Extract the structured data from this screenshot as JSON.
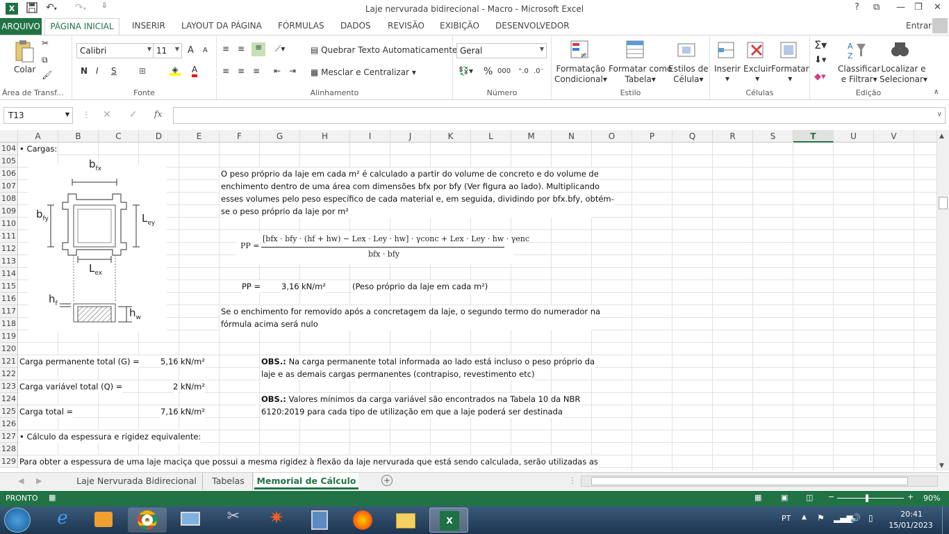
{
  "window": {
    "title": "Laje nervurada bidirecional - Macro - Microsoft Excel",
    "help": "?",
    "signin": "Entrar"
  },
  "tabs": [
    "ARQUIVO",
    "PÁGINA INICIAL",
    "INSERIR",
    "LAYOUT DA PÁGINA",
    "FÓRMULAS",
    "DADOS",
    "REVISÃO",
    "EXIBIÇÃO",
    "DESENVOLVEDOR"
  ],
  "ribbon": {
    "clipboard": {
      "paste": "Colar",
      "label": "Área de Transf..."
    },
    "font": {
      "name": "Calibri",
      "size": "11",
      "bold": "N",
      "italic": "I",
      "underline": "S",
      "label": "Fonte",
      "grow": "A",
      "shrink": "A",
      "color": "A"
    },
    "alignment": {
      "wrap": "Quebrar Texto Automaticamente",
      "merge": "Mesclar e Centralizar",
      "label": "Alinhamento"
    },
    "number": {
      "format": "Geral",
      "percent": "%",
      "thousands": "000",
      "label": "Número"
    },
    "styles": {
      "cond1": "Formatação",
      "cond2": "Condicional",
      "table1": "Formatar como",
      "table2": "Tabela",
      "cell1": "Estilos de",
      "cell2": "Célula",
      "label": "Estilo"
    },
    "cells": {
      "insert": "Inserir",
      "delete": "Excluir",
      "format": "Formatar",
      "label": "Células"
    },
    "editing": {
      "sort1": "Classificar",
      "sort2": "e Filtrar",
      "find1": "Localizar e",
      "find2": "Selecionar",
      "label": "Edição"
    }
  },
  "formula": {
    "namebox": "T13",
    "fx": "fx",
    "cancel": "✕",
    "enter": "✓"
  },
  "columns": [
    "A",
    "B",
    "C",
    "D",
    "E",
    "F",
    "G",
    "H",
    "I",
    "J",
    "K",
    "L",
    "M",
    "N",
    "O",
    "P",
    "Q",
    "R",
    "S",
    "T",
    "U",
    "V"
  ],
  "rows": [
    "104",
    "105",
    "106",
    "107",
    "108",
    "109",
    "110",
    "111",
    "112",
    "113",
    "114",
    "115",
    "116",
    "117",
    "118",
    "119",
    "120",
    "121",
    "122",
    "123",
    "124",
    "125",
    "126",
    "127",
    "128",
    "129"
  ],
  "cells": {
    "r104": "• Cargas:",
    "r106": "O peso próprio da laje em cada m² é calculado a partir do volume de concreto e do volume de",
    "r107": "enchimento dentro de uma área com dimensões bfx por bfy (Ver figura ao lado). Multiplicando",
    "r108": "esses volumes pelo peso específico de cada material e, em seguida, dividindo por bfx.bfy, obtém-",
    "r109": "se o peso próprio da laje por m²",
    "pp_label": "PP =",
    "pp_value": "3,16",
    "pp_unit": "kN/m²",
    "pp_note": "(Peso próprio da laje em cada m²)",
    "r117": "Se o enchimento for removido após a concretagem da laje, o segundo termo do numerador na",
    "r118": "fórmula acima será nulo",
    "g_label": "Carga permanente total (G) =",
    "g_value": "5,16",
    "g_unit": "kN/m²",
    "obs1_bold": "OBS.:",
    "obs1": " Na carga permanente total informada ao lado está incluso o peso próprio da",
    "obs1b": "laje e as demais cargas permanentes (contrapiso, revestimento etc)",
    "q_label": "Carga variável total (Q) =",
    "q_value": "2",
    "q_unit": "kN/m²",
    "obs2_bold": "OBS.:",
    "obs2": " Valores mínimos da carga variável são encontrados na Tabela 10 da NBR",
    "obs2b": "6120:2019 para cada tipo de utilização em que a laje poderá ser destinada",
    "t_label": "Carga total =",
    "t_value": "7,16",
    "t_unit": "kN/m²",
    "r127": "• Cálculo da espessura e rigidez equivalente:",
    "r129": "Para obter a espessura de uma laje maciça que possui a mesma rigidez à flexão da laje nervurada que está sendo calculada, serão utilizadas as"
  },
  "figure": {
    "bfx": "b",
    "bfx_sub": "fx",
    "bfy": "b",
    "bfy_sub": "fy",
    "ley": "L",
    "ley_sub": "ey",
    "lex": "L",
    "lex_sub": "ex",
    "hf": "h",
    "hf_sub": "f",
    "hw": "h",
    "hw_sub": "w"
  },
  "formula_eq": {
    "lhs": "PP =",
    "num": "[bfx · bfy · (hf + hw) − Lex · Ley · hw] · γconc + Lex · Ley · hw · γenc",
    "den": "bfx · bfy"
  },
  "sheets": [
    "Laje Nervurada Bidirecional",
    "Tabelas",
    "Memorial de Cálculo"
  ],
  "status": {
    "mode": "PRONTO",
    "zoom": "90%"
  },
  "taskbar": {
    "lang": "PT",
    "time": "20:41",
    "date": "15/01/2023"
  }
}
